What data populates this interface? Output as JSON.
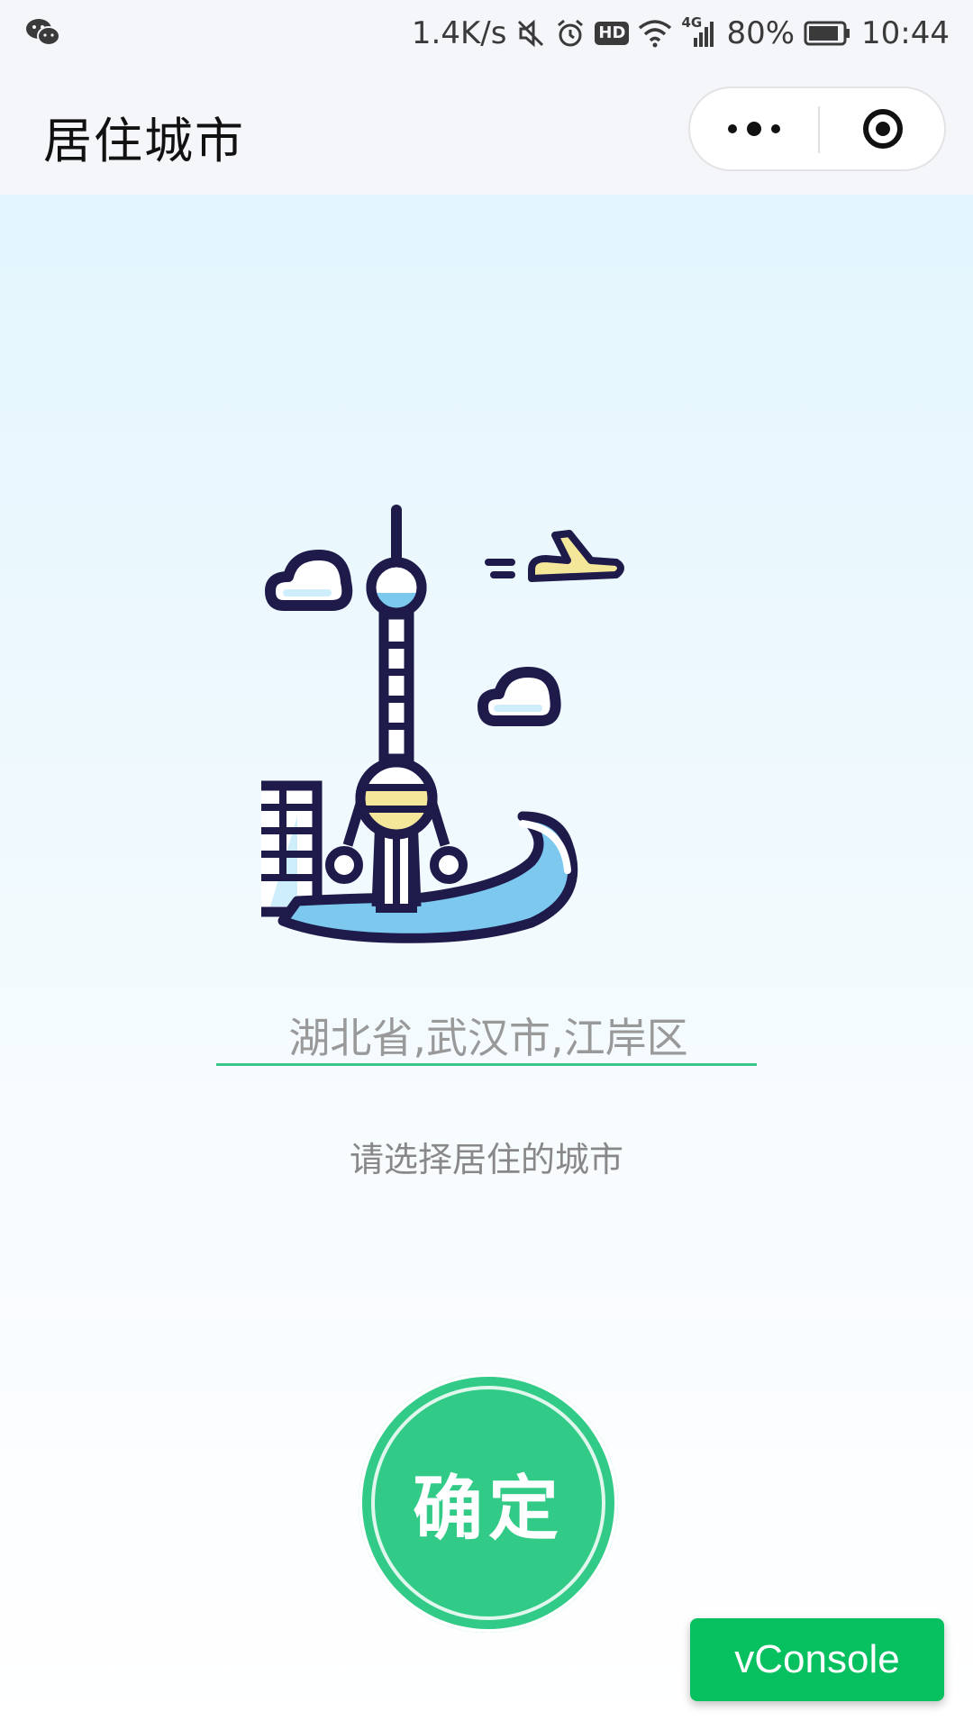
{
  "status_bar": {
    "network_speed": "1.4K/s",
    "hd_badge": "HD",
    "network_type": "4G",
    "battery": "80%",
    "time": "10:44",
    "icons": [
      "wechat-icon",
      "mute-icon",
      "alarm-icon",
      "hd-icon",
      "wifi-icon",
      "signal-icon",
      "battery-icon"
    ]
  },
  "nav": {
    "title": "居住城市",
    "capsule_icons": [
      "more-icon",
      "close-target-icon"
    ]
  },
  "illustration": {
    "icon": "city-skyline-tower-icon"
  },
  "form": {
    "city_value": "湖北省,武汉市,江岸区",
    "hint": "请选择居住的城市",
    "confirm_label": "确定"
  },
  "debug": {
    "vconsole_label": "vConsole"
  },
  "colors": {
    "accent_green": "#31cb87",
    "underline_green": "#3bc58a",
    "vconsole_green": "#07c160",
    "outline_navy": "#1e1b4b",
    "sky_blue": "#7cc8ee",
    "tower_yellow": "#f4e79a"
  }
}
